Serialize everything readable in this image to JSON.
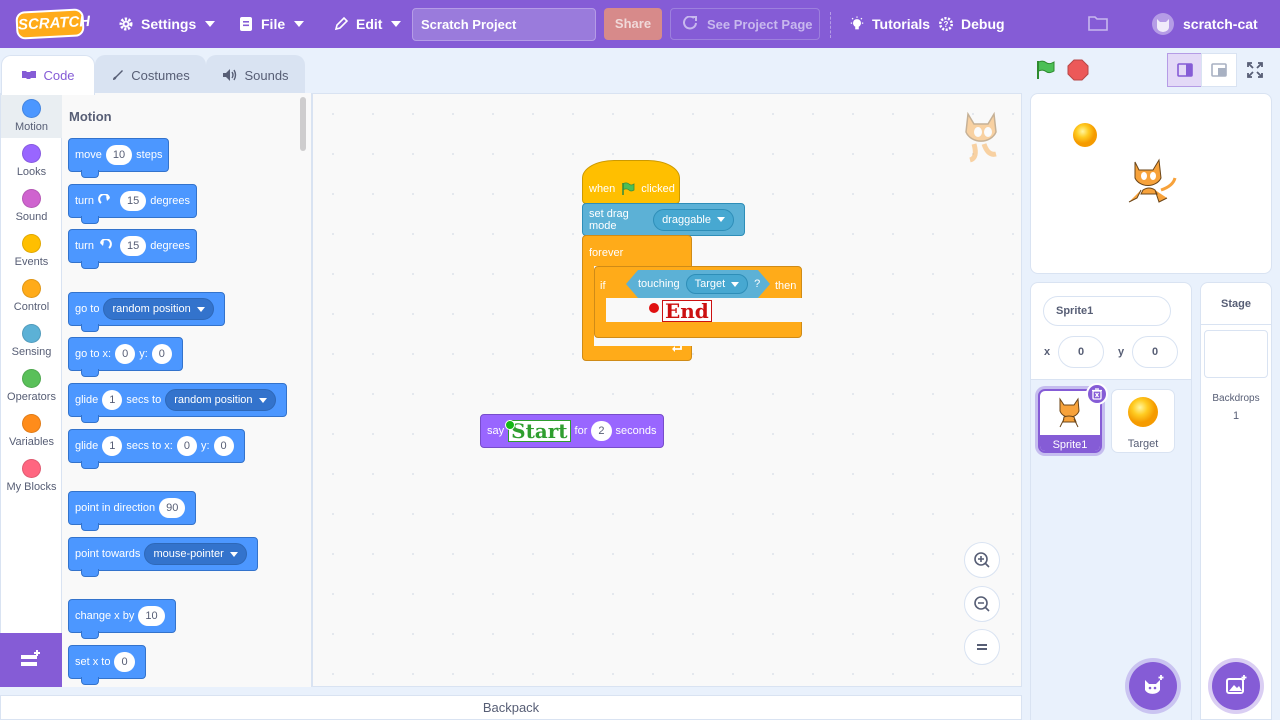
{
  "menubar": {
    "logo": "SCRATCH",
    "settings": "Settings",
    "file": "File",
    "edit": "Edit",
    "project_title": "Scratch Project",
    "share": "Share",
    "see_project_page": "See Project Page",
    "tutorials": "Tutorials",
    "debug": "Debug",
    "username": "scratch-cat"
  },
  "tabs": {
    "code": "Code",
    "costumes": "Costumes",
    "sounds": "Sounds"
  },
  "categories": [
    {
      "label": "Motion",
      "color": "#4c97ff"
    },
    {
      "label": "Looks",
      "color": "#9966ff"
    },
    {
      "label": "Sound",
      "color": "#cf63cf"
    },
    {
      "label": "Events",
      "color": "#ffbf00"
    },
    {
      "label": "Control",
      "color": "#ffab19"
    },
    {
      "label": "Sensing",
      "color": "#5cb1d6"
    },
    {
      "label": "Operators",
      "color": "#59c059"
    },
    {
      "label": "Variables",
      "color": "#ff8c1a"
    },
    {
      "label": "My Blocks",
      "color": "#ff6680"
    }
  ],
  "palette": {
    "heading": "Motion",
    "move": {
      "pre": "move",
      "value": "10",
      "post": "steps"
    },
    "turn_right": {
      "pre": "turn",
      "value": "15",
      "post": "degrees"
    },
    "turn_left": {
      "pre": "turn",
      "value": "15",
      "post": "degrees"
    },
    "go_to": {
      "pre": "go to",
      "menu": "random position"
    },
    "go_to_xy": {
      "pre": "go to x:",
      "x": "0",
      "mid": "y:",
      "y": "0"
    },
    "glide_to": {
      "pre": "glide",
      "secs": "1",
      "mid": "secs to",
      "menu": "random position"
    },
    "glide_xy": {
      "pre": "glide",
      "secs": "1",
      "mid": "secs to x:",
      "x": "0",
      "ylabel": "y:",
      "y": "0"
    },
    "point_dir": {
      "pre": "point in direction",
      "value": "90"
    },
    "point_towards": {
      "pre": "point towards",
      "menu": "mouse-pointer"
    },
    "change_x": {
      "pre": "change x by",
      "value": "10"
    },
    "set_x": {
      "pre": "set x to",
      "value": "0"
    }
  },
  "script": {
    "when_flag": {
      "pre": "when",
      "post": "clicked"
    },
    "drag_mode": {
      "pre": "set drag mode",
      "menu": "draggable"
    },
    "forever": "forever",
    "if": "if",
    "touching": {
      "pre": "touching",
      "menu": "Target",
      "post": "?"
    },
    "then": "then",
    "end_label": "End",
    "say": {
      "pre": "say",
      "mid": "for",
      "value": "2",
      "post": "seconds"
    },
    "start_label": "Start"
  },
  "sprite_info": {
    "name": "Sprite1",
    "x_label": "x",
    "x": "0",
    "y_label": "y",
    "y": "0"
  },
  "sprites": [
    {
      "name": "Sprite1",
      "selected": true
    },
    {
      "name": "Target",
      "selected": false
    }
  ],
  "stage_pane": {
    "title": "Stage",
    "backdrops_label": "Backdrops",
    "backdrops_count": "1"
  },
  "backpack": "Backpack",
  "colors": {
    "brand": "#855cd6",
    "motion": "#4c97ff",
    "events": "#ffbf00",
    "control": "#ffab19",
    "sensing": "#5cb1d6",
    "looks": "#9966ff"
  }
}
